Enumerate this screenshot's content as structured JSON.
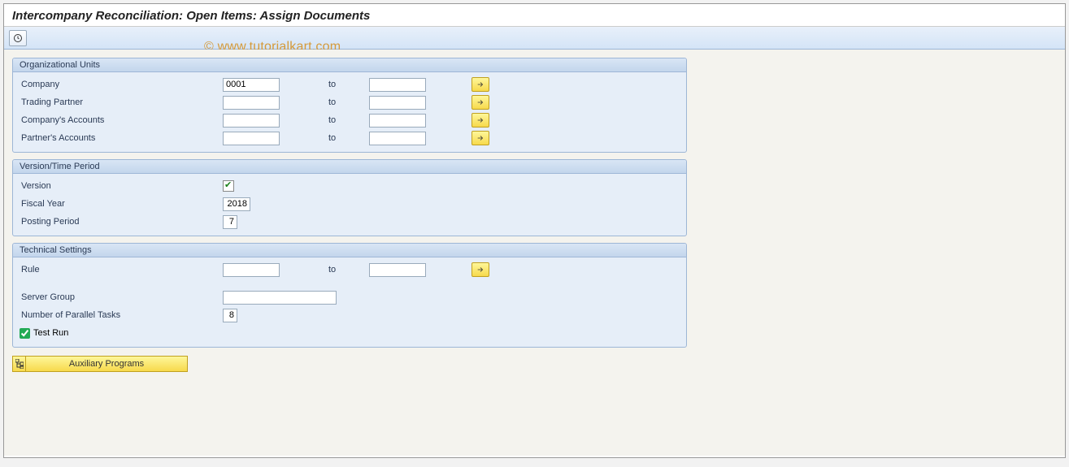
{
  "title": "Intercompany Reconciliation: Open Items: Assign Documents",
  "watermark": "© www.tutorialkart.com",
  "groups": {
    "org": {
      "title": "Organizational Units",
      "company": {
        "label": "Company",
        "from": "0001",
        "to_label": "to",
        "to": ""
      },
      "trading_partner": {
        "label": "Trading Partner",
        "from": "",
        "to_label": "to",
        "to": ""
      },
      "company_accounts": {
        "label": "Company's Accounts",
        "from": "",
        "to_label": "to",
        "to": ""
      },
      "partner_accounts": {
        "label": "Partner's Accounts",
        "from": "",
        "to_label": "to",
        "to": ""
      }
    },
    "version": {
      "title": "Version/Time Period",
      "version": {
        "label": "Version",
        "checked": true
      },
      "fiscal_year": {
        "label": "Fiscal Year",
        "value": "2018"
      },
      "posting_period": {
        "label": "Posting Period",
        "value": "7"
      }
    },
    "tech": {
      "title": "Technical Settings",
      "rule": {
        "label": "Rule",
        "from": "",
        "to_label": "to",
        "to": ""
      },
      "server_group": {
        "label": "Server Group",
        "value": ""
      },
      "parallel_tasks": {
        "label": "Number of Parallel Tasks",
        "value": "8"
      },
      "test_run": {
        "label": "Test Run",
        "checked": true
      }
    }
  },
  "aux_button": "Auxiliary Programs"
}
